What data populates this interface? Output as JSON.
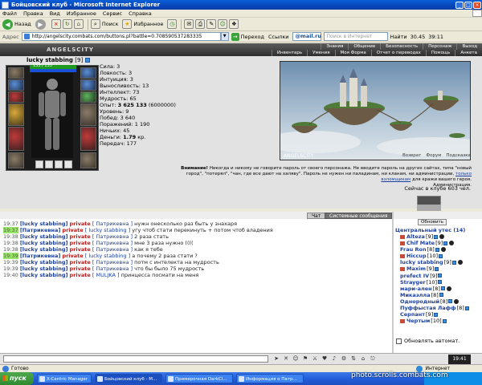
{
  "window": {
    "title": "Бойцовский клуб - Microsoft Internet Explorer"
  },
  "menu": [
    "Файл",
    "Правка",
    "Вид",
    "Избранное",
    "Сервис",
    "Справка"
  ],
  "toolbar": {
    "back": "Назад",
    "search": "Поиск",
    "favorites": "Избранное"
  },
  "address": {
    "label": "Адрес",
    "url": "http://angelscity.combats.com/buttons.pl?battle=0.708590537283335",
    "go_label": "Переход",
    "links_label": "Ссылки",
    "mailru": "@mail.ru",
    "search_placeholder": "Поиск в Интернет",
    "find_label": "Найти",
    "temp": "30.45",
    "time": "39:11"
  },
  "game": {
    "logo": "ANGELSCITY",
    "nav_top": [
      "Знания",
      "Общение",
      "Безопасность",
      "Персонаж",
      "Выход"
    ],
    "nav_bottom": [
      "Инвентарь",
      "Умения",
      "Моя Форма",
      "Отчет о переводах",
      "Помощь",
      "Анкета"
    ],
    "character": {
      "name": "lucky stabbing",
      "level": "[9]",
      "hp_text": "133 / 133",
      "hp_fill": 1.0,
      "mana_fill": 1.0
    },
    "stats": [
      "Сила: 3",
      "Ловкость: 3",
      "Интуиция: 3",
      "Выносливость: 13",
      "Интеллект: 73",
      "Мудрость: 65"
    ],
    "stats2": {
      "exp_label": "Опыт:",
      "exp_value": "3 625 133",
      "exp_next": "(6000000)",
      "level_line": "Уровень: 9",
      "wins": "Побед: 3 640",
      "losses": "Поражений: 1 190",
      "draws": "Ничьих: 45",
      "money_label": "Деньги:",
      "money_value": "1.79",
      "money_unit": "кр.",
      "transfers": "Передач: 177"
    },
    "banner_links": [
      "Возврат",
      "Форум",
      "Подсказка"
    ],
    "warning_bold": "Внимание!",
    "warning_text": "Никогда и никому не говорите пароль от своего персонажа. Не вводите пароль на других сайтах, типа \"новый город\", \"потерял\", \"чан, где все дают на халяву\". Пароль не нужен ни паладинам, ни кланам, ни администрации,",
    "warning_link": "только взломщикам",
    "warning_tail": "для кражи вашего героя.",
    "admin": "Администрация.",
    "online": "Сейчас в клубе 603 чел."
  },
  "chat": {
    "tab_chat": "Чат",
    "tab_system": "Системные сообщения",
    "messages": [
      {
        "time": "19:37",
        "hl": false,
        "from": "[lucky stabbing]",
        "priv": "private",
        "to": "[ Патрикевна ]",
        "text": "нужн онесколько раз быть у знахаря"
      },
      {
        "time": "19:37",
        "hl": true,
        "from": "[Патрикевна]",
        "priv": "private",
        "to": "[ lucky stabbing ]",
        "text": "угу чтоб стати перекинуть + потом чтоб владения"
      },
      {
        "time": "19:38",
        "hl": false,
        "from": "[lucky stabbing]",
        "priv": "private",
        "to": "[ Патрикевна ]",
        "text": "2 раза стать"
      },
      {
        "time": "19:38",
        "hl": false,
        "from": "[lucky stabbing]",
        "priv": "private",
        "to": "[ Патрикевна ]",
        "text": "мне 3 раза нужно (((("
      },
      {
        "time": "19:38",
        "hl": false,
        "from": "[lucky stabbing]",
        "priv": "private",
        "to": "[ Патрикевна ]",
        "text": "как я тебе"
      },
      {
        "time": "19:39",
        "hl": true,
        "from": "[Патрикевна]",
        "priv": "private",
        "to": "[ lucky stabbing ]",
        "text": "а почему 2 раза стати ?"
      },
      {
        "time": "19:39",
        "hl": false,
        "from": "[lucky stabbing]",
        "priv": "private",
        "to": "[ Патрикевна ]",
        "text": "потм с интелекта на мудрость"
      },
      {
        "time": "19:39",
        "hl": false,
        "from": "[lucky stabbing]",
        "priv": "private",
        "to": "[ Патрикевна ]",
        "text": "что бы было 75 мудрость"
      },
      {
        "time": "19:40",
        "hl": false,
        "from": "[lucky stabbing]",
        "priv": "private",
        "to": "[ MULJKA ]",
        "text": "принцесса посмати на меня"
      }
    ]
  },
  "users": {
    "refresh": "Обновить",
    "location": "Центральный утес (14)",
    "list": [
      {
        "name": "Alteza",
        "level": "[9]",
        "klan": true,
        "emb": true
      },
      {
        "name": "Chif Mate",
        "level": "[9]",
        "klan": true,
        "emb": true
      },
      {
        "name": "Frau Ron",
        "level": "[8]",
        "klan": false,
        "emb": true
      },
      {
        "name": "Hiccup",
        "level": "[10]",
        "klan": true,
        "emb": false
      },
      {
        "name": "lucky stabbing",
        "level": "[9]",
        "klan": false,
        "emb": true
      },
      {
        "name": "Maxim",
        "level": "[9]",
        "klan": true,
        "emb": false
      },
      {
        "name": "prefect IV",
        "level": "[9]",
        "klan": false,
        "emb": false
      },
      {
        "name": "Strayger",
        "level": "[10]",
        "klan": false,
        "emb": false
      },
      {
        "name": "мари-ален",
        "level": "[8]",
        "klan": false,
        "emb": true
      },
      {
        "name": "Микаэлла",
        "level": "[8]",
        "klan": false,
        "emb": false
      },
      {
        "name": "Однородный",
        "level": "[8]",
        "klan": false,
        "emb": true
      },
      {
        "name": "Пуффыстая Лафф",
        "level": "[8]",
        "klan": false,
        "emb": false
      },
      {
        "name": "Серпант",
        "level": "[9]",
        "klan": false,
        "emb": false
      },
      {
        "name": "Чертым",
        "level": "[10]",
        "klan": true,
        "emb": false
      }
    ],
    "auto_label": "Обновлять автомат."
  },
  "inputbar": {
    "clock": "19:41"
  },
  "status": {
    "left": "Готово",
    "zone": "Интернет"
  },
  "taskbar": {
    "start": "пуск",
    "tasks": [
      "X-Centric Manager",
      "Бойцовский клуб - M...",
      "Примерочная DarkCl...",
      "Информация о Патр..."
    ],
    "watermark": "photo.scrolls.combats.com"
  },
  "colors": {
    "ie_title": "#0846b8",
    "private": "#c01818",
    "nick": "#1a3fa0",
    "highlight_time": "#9ae56a"
  }
}
